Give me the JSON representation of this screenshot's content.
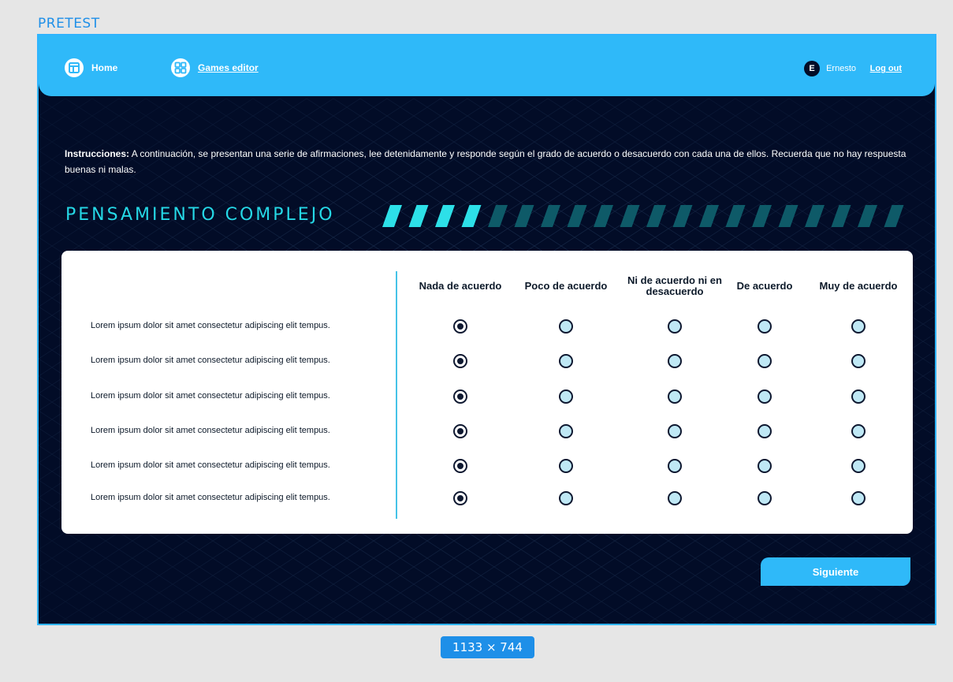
{
  "frame": {
    "label": "PRETEST",
    "size_badge": "1133 × 744"
  },
  "topbar": {
    "home_label": "Home",
    "games_label": "Games editor",
    "user_initial": "E",
    "user_name": "Ernesto",
    "logout_label": "Log out"
  },
  "instructions": {
    "lead": "Instrucciones:",
    "text": " A continuación, se presentan una serie de afirmaciones, lee detenidamente y responde según el grado de acuerdo o desacuerdo con cada una de ellos. Recuerda que no hay respuesta buenas ni malas."
  },
  "section": {
    "title": "PENSAMIENTO COMPLEJO",
    "progress": {
      "completed": 4,
      "total": 20
    }
  },
  "survey": {
    "columns": [
      "Nada de acuerdo",
      "Poco de acuerdo",
      "Ni de acuerdo ni en desacuerdo",
      "De acuerdo",
      "Muy de acuerdo"
    ],
    "rows": [
      {
        "statement": "Lorem ipsum dolor sit amet consectetur adipiscing elit tempus.",
        "selected": 0
      },
      {
        "statement": "Lorem ipsum dolor sit amet consectetur adipiscing elit tempus.",
        "selected": 0
      },
      {
        "statement": "Lorem ipsum dolor sit amet consectetur adipiscing elit tempus.",
        "selected": 0
      },
      {
        "statement": "Lorem ipsum dolor sit amet consectetur adipiscing elit tempus.",
        "selected": 0
      },
      {
        "statement": "Lorem ipsum dolor sit amet consectetur adipiscing elit tempus.",
        "selected": 0
      },
      {
        "statement": "Lorem ipsum dolor sit amet consectetur adipiscing elit tempus.",
        "selected": 0
      }
    ]
  },
  "next_button": "Siguiente",
  "colors": {
    "accent": "#2fb9f9",
    "background": "#020c27",
    "title_cyan": "#25d8e6",
    "progress_done": "#2de0e8",
    "progress_todo": "#0e5a68"
  }
}
